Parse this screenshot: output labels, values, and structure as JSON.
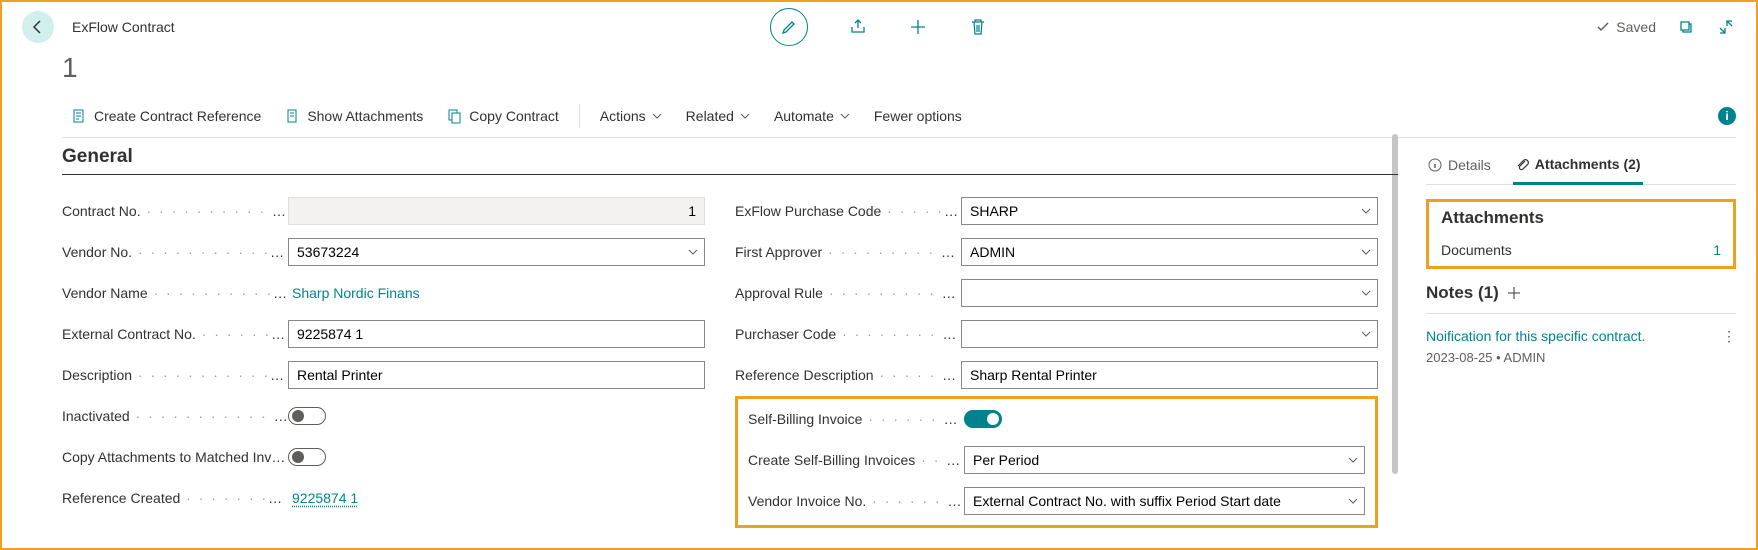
{
  "header": {
    "title": "ExFlow Contract",
    "saved_label": "Saved"
  },
  "record_no": "1",
  "actions": {
    "create_ref": "Create Contract Reference",
    "show_att": "Show Attachments",
    "copy": "Copy Contract",
    "actions": "Actions",
    "related": "Related",
    "automate": "Automate",
    "fewer": "Fewer options"
  },
  "section_general": "General",
  "left": {
    "contract_no_label": "Contract No.",
    "contract_no": "1",
    "vendor_no_label": "Vendor No.",
    "vendor_no": "53673224",
    "vendor_name_label": "Vendor Name",
    "vendor_name": "Sharp Nordic Finans",
    "ext_contract_label": "External Contract No.",
    "ext_contract": "9225874 1",
    "desc_label": "Description",
    "desc": "Rental Printer",
    "inactivated_label": "Inactivated",
    "copy_att_label": "Copy Attachments to Matched Invo...",
    "ref_created_label": "Reference Created",
    "ref_created": "9225874 1"
  },
  "right": {
    "purchase_code_label": "ExFlow Purchase Code",
    "purchase_code": "SHARP",
    "first_approver_label": "First Approver",
    "first_approver": "ADMIN",
    "approval_rule_label": "Approval Rule",
    "approval_rule": "",
    "purchaser_code_label": "Purchaser Code",
    "purchaser_code": "",
    "ref_desc_label": "Reference Description",
    "ref_desc": "Sharp Rental Printer",
    "self_billing_label": "Self-Billing Invoice",
    "create_sbi_label": "Create Self-Billing Invoices",
    "create_sbi": "Per Period",
    "vendor_inv_label": "Vendor Invoice No.",
    "vendor_inv": "External Contract No. with suffix Period Start date"
  },
  "factbox": {
    "tab_details": "Details",
    "tab_attachments": "Attachments (2)",
    "att_heading": "Attachments",
    "documents_label": "Documents",
    "documents_count": "1",
    "notes_heading": "Notes (1)",
    "note_title": "Noification for this specific contract.",
    "note_meta": "2023-08-25 • ADMIN"
  }
}
